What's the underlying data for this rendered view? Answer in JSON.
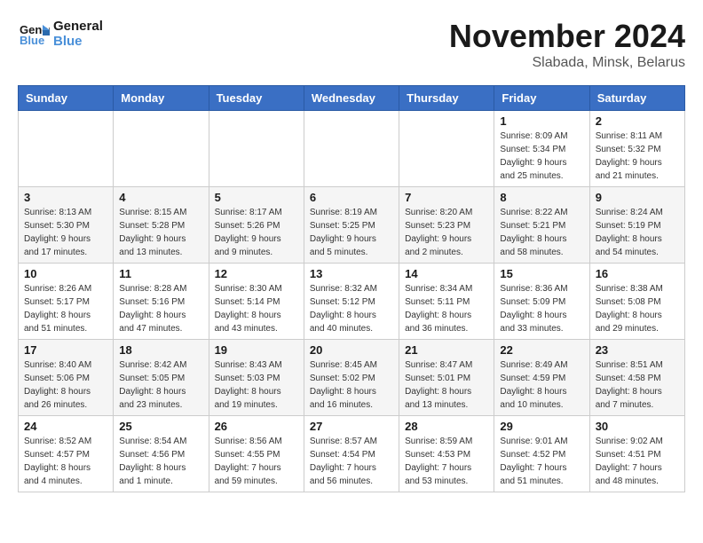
{
  "header": {
    "logo_line1": "General",
    "logo_line2": "Blue",
    "month": "November 2024",
    "location": "Slabada, Minsk, Belarus"
  },
  "weekdays": [
    "Sunday",
    "Monday",
    "Tuesday",
    "Wednesday",
    "Thursday",
    "Friday",
    "Saturday"
  ],
  "weeks": [
    [
      {
        "day": "",
        "info": ""
      },
      {
        "day": "",
        "info": ""
      },
      {
        "day": "",
        "info": ""
      },
      {
        "day": "",
        "info": ""
      },
      {
        "day": "",
        "info": ""
      },
      {
        "day": "1",
        "info": "Sunrise: 8:09 AM\nSunset: 5:34 PM\nDaylight: 9 hours\nand 25 minutes."
      },
      {
        "day": "2",
        "info": "Sunrise: 8:11 AM\nSunset: 5:32 PM\nDaylight: 9 hours\nand 21 minutes."
      }
    ],
    [
      {
        "day": "3",
        "info": "Sunrise: 8:13 AM\nSunset: 5:30 PM\nDaylight: 9 hours\nand 17 minutes."
      },
      {
        "day": "4",
        "info": "Sunrise: 8:15 AM\nSunset: 5:28 PM\nDaylight: 9 hours\nand 13 minutes."
      },
      {
        "day": "5",
        "info": "Sunrise: 8:17 AM\nSunset: 5:26 PM\nDaylight: 9 hours\nand 9 minutes."
      },
      {
        "day": "6",
        "info": "Sunrise: 8:19 AM\nSunset: 5:25 PM\nDaylight: 9 hours\nand 5 minutes."
      },
      {
        "day": "7",
        "info": "Sunrise: 8:20 AM\nSunset: 5:23 PM\nDaylight: 9 hours\nand 2 minutes."
      },
      {
        "day": "8",
        "info": "Sunrise: 8:22 AM\nSunset: 5:21 PM\nDaylight: 8 hours\nand 58 minutes."
      },
      {
        "day": "9",
        "info": "Sunrise: 8:24 AM\nSunset: 5:19 PM\nDaylight: 8 hours\nand 54 minutes."
      }
    ],
    [
      {
        "day": "10",
        "info": "Sunrise: 8:26 AM\nSunset: 5:17 PM\nDaylight: 8 hours\nand 51 minutes."
      },
      {
        "day": "11",
        "info": "Sunrise: 8:28 AM\nSunset: 5:16 PM\nDaylight: 8 hours\nand 47 minutes."
      },
      {
        "day": "12",
        "info": "Sunrise: 8:30 AM\nSunset: 5:14 PM\nDaylight: 8 hours\nand 43 minutes."
      },
      {
        "day": "13",
        "info": "Sunrise: 8:32 AM\nSunset: 5:12 PM\nDaylight: 8 hours\nand 40 minutes."
      },
      {
        "day": "14",
        "info": "Sunrise: 8:34 AM\nSunset: 5:11 PM\nDaylight: 8 hours\nand 36 minutes."
      },
      {
        "day": "15",
        "info": "Sunrise: 8:36 AM\nSunset: 5:09 PM\nDaylight: 8 hours\nand 33 minutes."
      },
      {
        "day": "16",
        "info": "Sunrise: 8:38 AM\nSunset: 5:08 PM\nDaylight: 8 hours\nand 29 minutes."
      }
    ],
    [
      {
        "day": "17",
        "info": "Sunrise: 8:40 AM\nSunset: 5:06 PM\nDaylight: 8 hours\nand 26 minutes."
      },
      {
        "day": "18",
        "info": "Sunrise: 8:42 AM\nSunset: 5:05 PM\nDaylight: 8 hours\nand 23 minutes."
      },
      {
        "day": "19",
        "info": "Sunrise: 8:43 AM\nSunset: 5:03 PM\nDaylight: 8 hours\nand 19 minutes."
      },
      {
        "day": "20",
        "info": "Sunrise: 8:45 AM\nSunset: 5:02 PM\nDaylight: 8 hours\nand 16 minutes."
      },
      {
        "day": "21",
        "info": "Sunrise: 8:47 AM\nSunset: 5:01 PM\nDaylight: 8 hours\nand 13 minutes."
      },
      {
        "day": "22",
        "info": "Sunrise: 8:49 AM\nSunset: 4:59 PM\nDaylight: 8 hours\nand 10 minutes."
      },
      {
        "day": "23",
        "info": "Sunrise: 8:51 AM\nSunset: 4:58 PM\nDaylight: 8 hours\nand 7 minutes."
      }
    ],
    [
      {
        "day": "24",
        "info": "Sunrise: 8:52 AM\nSunset: 4:57 PM\nDaylight: 8 hours\nand 4 minutes."
      },
      {
        "day": "25",
        "info": "Sunrise: 8:54 AM\nSunset: 4:56 PM\nDaylight: 8 hours\nand 1 minute."
      },
      {
        "day": "26",
        "info": "Sunrise: 8:56 AM\nSunset: 4:55 PM\nDaylight: 7 hours\nand 59 minutes."
      },
      {
        "day": "27",
        "info": "Sunrise: 8:57 AM\nSunset: 4:54 PM\nDaylight: 7 hours\nand 56 minutes."
      },
      {
        "day": "28",
        "info": "Sunrise: 8:59 AM\nSunset: 4:53 PM\nDaylight: 7 hours\nand 53 minutes."
      },
      {
        "day": "29",
        "info": "Sunrise: 9:01 AM\nSunset: 4:52 PM\nDaylight: 7 hours\nand 51 minutes."
      },
      {
        "day": "30",
        "info": "Sunrise: 9:02 AM\nSunset: 4:51 PM\nDaylight: 7 hours\nand 48 minutes."
      }
    ]
  ]
}
